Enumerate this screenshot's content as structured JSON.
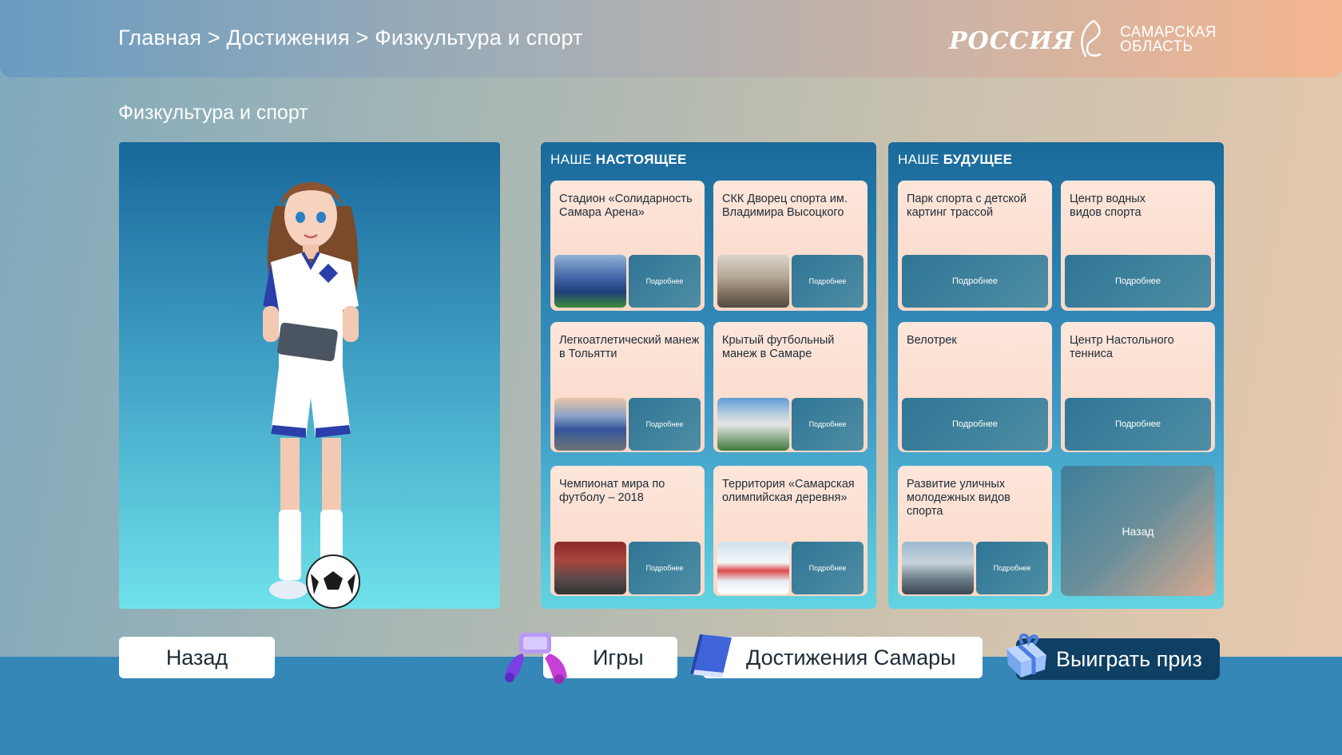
{
  "breadcrumb": "Главная > Достижения > Физкультура и спорт",
  "logos": {
    "russia": "РОССИЯ",
    "samara_line1": "САМАРСКАЯ",
    "samara_line2": "ОБЛАСТЬ"
  },
  "page_title": "Физкультура и спорт",
  "present": {
    "title_prefix": "НАШЕ",
    "title_bold": "НАСТОЯЩЕЕ",
    "cards": [
      {
        "title": "Стадион «Солидарность Самара Арена»",
        "button": "Подробнее"
      },
      {
        "title": "СКК Дворец спорта им. Владимира Высоцкого",
        "button": "Подробнее"
      },
      {
        "title": "Легкоатлетический манеж в Тольятти",
        "button": "Подробнее"
      },
      {
        "title": "Крытый футбольный манеж в Самаре",
        "button": "Подробнее"
      },
      {
        "title": "Чемпионат мира по футболу – 2018",
        "button": "Подробнее"
      },
      {
        "title": "Территория «Самарская олимпийская деревня»",
        "button": "Подробнее"
      }
    ]
  },
  "future": {
    "title_prefix": "НАШЕ",
    "title_bold": "БУДУЩЕЕ",
    "cards": [
      {
        "title": "Парк спорта с детской картинг трассой",
        "button": "Подробнее"
      },
      {
        "title": "Центр водных видов спорта",
        "button": "Подробнее"
      },
      {
        "title": "Велотрек",
        "button": "Подробнее"
      },
      {
        "title": "Центр Настольного тенниса",
        "button": "Подробнее"
      },
      {
        "title": "Развитие уличных молодежных видов спорта",
        "button": "Подробнее"
      }
    ],
    "back_label": "Назад"
  },
  "bottom_nav": {
    "back": "Назад",
    "games": "Игры",
    "achievements": "Достижения Самары",
    "prize": "Выиграть приз"
  },
  "icons": [
    "samara-emblem-icon",
    "tablet-hands-icon",
    "book-icon",
    "gift-icon"
  ]
}
